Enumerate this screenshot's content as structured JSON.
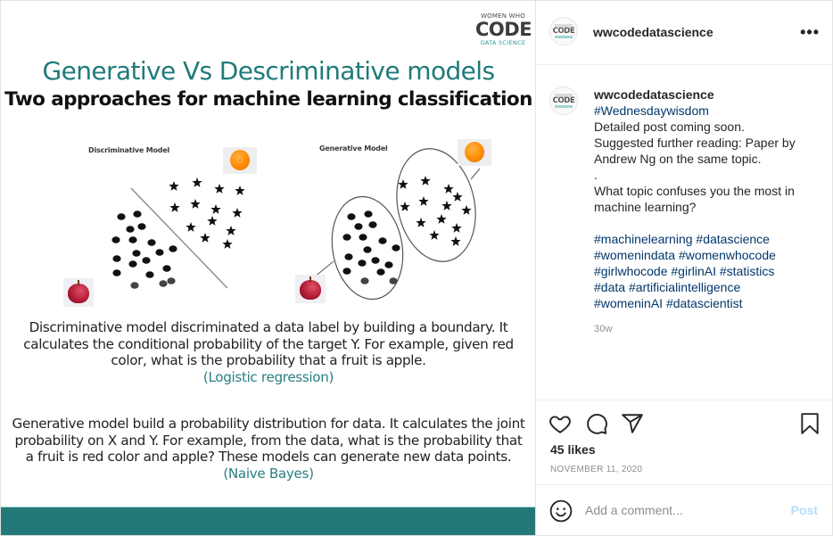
{
  "post_image": {
    "logo": {
      "line1": "WOMEN WHO",
      "line2": "CODE",
      "line3": "DATA SCIENCE"
    },
    "title": "Generative Vs Descriminative models",
    "subtitle": "Two approaches for machine learning classification",
    "discriminative_panel": {
      "label": "Discriminative Model",
      "class_a_icon": "apple-image",
      "class_b_icon": "orange-image",
      "class_a_marker": "dot",
      "class_b_marker": "star"
    },
    "generative_panel": {
      "label": "Generative Model",
      "class_a_icon": "apple-image",
      "class_b_icon": "orange-image",
      "class_a_marker": "dot",
      "class_b_marker": "star"
    },
    "discriminative_text": "Discriminative model discriminated a data label by building a boundary. It calculates the conditional probability of the target Y. For example, given red color, what is the probability that a fruit is apple.",
    "discriminative_algo": "(Logistic regression)",
    "generative_text": "Generative model build a probability distribution for data. It calculates the joint probability on X and Y. For example, from the data, what is the probability that a fruit is red color and apple? These models can generate new data points.",
    "generative_algo": "(Naive Bayes)",
    "colors": {
      "title": "#1f7a7a",
      "algo": "#2a8080",
      "footer_bar": "#257878"
    }
  },
  "header": {
    "username": "wwcodedatascience",
    "avatar_text": "CODE",
    "more_icon": "more-horizontal-icon",
    "more_label": "•••"
  },
  "caption": {
    "username": "wwcodedatascience",
    "hashtag_top": "#Wednesdaywisdom",
    "lines": [
      "Detailed post coming soon.",
      "Suggested further reading: Paper by Andrew Ng on the same topic.",
      ".",
      "What topic confuses you the most in machine learning?"
    ],
    "hashtags": [
      "#machinelearning",
      "#datascience",
      "#womenindata",
      "#womenwhocode",
      "#girlwhocode",
      "#girlinAI",
      "#statistics",
      "#data",
      "#artificialintelligence",
      "#womeninAI",
      "#datascientist"
    ],
    "time_ago": "30w"
  },
  "actions": {
    "icons": [
      "heart-icon",
      "comment-icon",
      "share-icon",
      "bookmark-icon"
    ],
    "likes": "45 likes",
    "date": "NOVEMBER 11, 2020"
  },
  "comment_box": {
    "placeholder": "Add a comment...",
    "value": "",
    "post_label": "Post",
    "emoji_icon": "smiley-icon"
  },
  "colors": {
    "link": "#00376b",
    "muted": "#8e8e8e",
    "post_disabled": "#b2dffc",
    "text": "#262626"
  }
}
